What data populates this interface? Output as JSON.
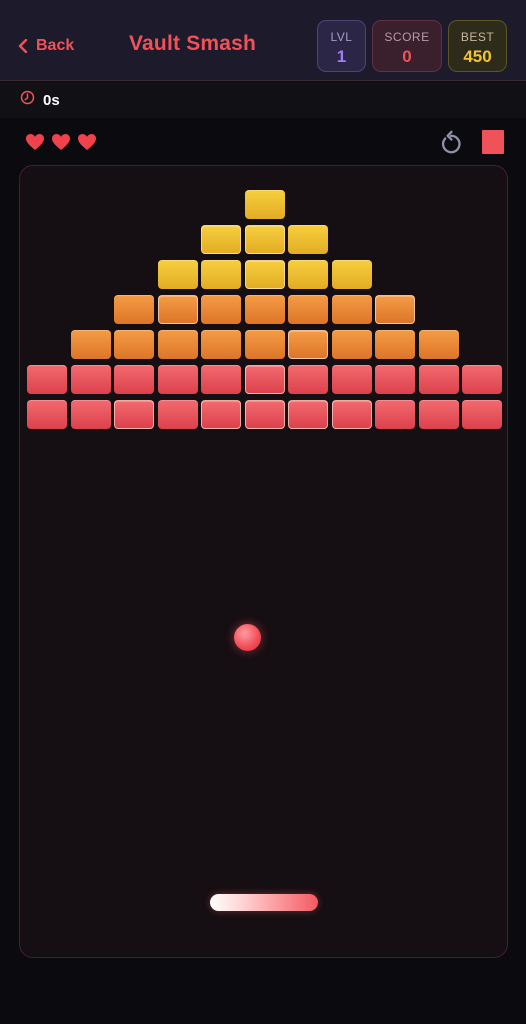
{
  "header": {
    "back_label": "Back",
    "title": "Vault Smash",
    "level": {
      "label": "LVL",
      "value": "1"
    },
    "score": {
      "label": "SCORE",
      "value": "0"
    },
    "best": {
      "label": "BEST",
      "value": "450"
    }
  },
  "timer": {
    "value": "0s",
    "icon": "clock-icon"
  },
  "hud": {
    "lives": 3,
    "icons": [
      "heart-icon",
      "restart-icon",
      "pause-icon"
    ]
  },
  "colors": {
    "accent": "#f0525a",
    "brick_yellow": "#f1c531",
    "brick_orange": "#ee8a39",
    "brick_red": "#e95560",
    "level_purple": "#a27cf5"
  },
  "bricks": {
    "rows": [
      {
        "color": "yellow",
        "columns": [
          5
        ]
      },
      {
        "color": "yellow",
        "columns": [
          4,
          5,
          6
        ]
      },
      {
        "color": "yellow",
        "columns": [
          3,
          4,
          5,
          6,
          7
        ]
      },
      {
        "color": "orange",
        "columns": [
          2,
          3,
          4,
          5,
          6,
          7,
          8
        ]
      },
      {
        "color": "orange",
        "columns": [
          1,
          2,
          3,
          4,
          5,
          6,
          7,
          8,
          9
        ]
      },
      {
        "color": "red",
        "columns": [
          0,
          1,
          2,
          3,
          4,
          5,
          6,
          7,
          8,
          9,
          10
        ]
      },
      {
        "color": "red",
        "columns": [
          0,
          1,
          2,
          3,
          4,
          5,
          6,
          7,
          8,
          9,
          10
        ]
      }
    ],
    "highlighted": [
      [
        1,
        4
      ],
      [
        1,
        5
      ],
      [
        2,
        5
      ],
      [
        3,
        3
      ],
      [
        3,
        8
      ],
      [
        4,
        6
      ],
      [
        5,
        5
      ],
      [
        6,
        2
      ],
      [
        6,
        4
      ],
      [
        6,
        5
      ],
      [
        6,
        6
      ],
      [
        6,
        7
      ]
    ]
  }
}
